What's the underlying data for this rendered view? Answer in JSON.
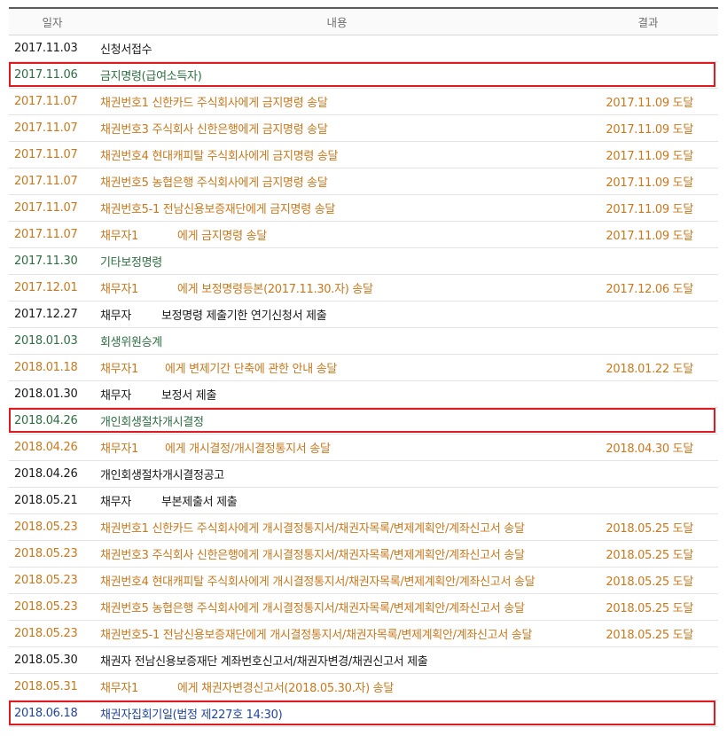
{
  "header": {
    "date": "일자",
    "content": "내용",
    "result": "결과"
  },
  "rows": [
    {
      "date": "2017.11.03",
      "content": "신청서접수",
      "result": "",
      "color": "black"
    },
    {
      "date": "2017.11.06",
      "content": "금지명령(급여소득자)",
      "result": "",
      "color": "green",
      "highlighted": true
    },
    {
      "date": "2017.11.07",
      "content": "채권번호1 신한카드 주식회사에게 금지명령 송달",
      "result": "2017.11.09 도달",
      "color": "orange"
    },
    {
      "date": "2017.11.07",
      "content": "채권번호3 주식회사 신한은행에게 금지명령 송달",
      "result": "2017.11.09 도달",
      "color": "orange"
    },
    {
      "date": "2017.11.07",
      "content": "채권번호4 현대캐피탈 주식회사에게 금지명령 송달",
      "result": "2017.11.09 도달",
      "color": "orange"
    },
    {
      "date": "2017.11.07",
      "content": "채권번호5 농협은행 주식회사에게 금지명령 송달",
      "result": "2017.11.09 도달",
      "color": "orange"
    },
    {
      "date": "2017.11.07",
      "content": "채권번호5-1 전남신용보증재단에게 금지명령 송달",
      "result": "2017.11.09 도달",
      "color": "orange"
    },
    {
      "date": "2017.11.07",
      "content": "채무자1",
      "content2": "에게 금지명령 송달",
      "gap": 44,
      "result": "2017.11.09 도달",
      "color": "orange"
    },
    {
      "date": "2017.11.30",
      "content": "기타보정명령",
      "result": "",
      "color": "green"
    },
    {
      "date": "2017.12.01",
      "content": "채무자1",
      "content2": "에게 보정명령등본(2017.11.30.자) 송달",
      "gap": 44,
      "result": "2017.12.06 도달",
      "color": "orange"
    },
    {
      "date": "2017.12.27",
      "content": "채무자",
      "content2": "보정명령 제출기한 연기신청서 제출",
      "gap": 34,
      "result": "",
      "color": "black"
    },
    {
      "date": "2018.01.03",
      "content": "회생위원승계",
      "result": "",
      "color": "green"
    },
    {
      "date": "2018.01.18",
      "content": "채무자1",
      "content2": "에게 변제기간 단축에 관한 안내 송달",
      "gap": 30,
      "result": "2018.01.22 도달",
      "color": "orange"
    },
    {
      "date": "2018.01.30",
      "content": "채무자",
      "content2": "보정서 제출",
      "gap": 34,
      "result": "",
      "color": "black"
    },
    {
      "date": "2018.04.26",
      "content": "개인회생절차개시결정",
      "result": "",
      "color": "green",
      "highlighted": true
    },
    {
      "date": "2018.04.26",
      "content": "채무자1",
      "content2": "에게 개시결정/개시결정통지서 송달",
      "gap": 30,
      "result": "2018.04.30 도달",
      "color": "orange"
    },
    {
      "date": "2018.04.26",
      "content": "개인회생절차개시결정공고",
      "result": "",
      "color": "black"
    },
    {
      "date": "2018.05.21",
      "content": "채무자",
      "content2": "부본제출서 제출",
      "gap": 34,
      "result": "",
      "color": "black"
    },
    {
      "date": "2018.05.23",
      "content": "채권번호1 신한카드 주식회사에게 개시결정통지서/채권자목록/변제계획안/계좌신고서 송달",
      "result": "2018.05.25 도달",
      "color": "orange"
    },
    {
      "date": "2018.05.23",
      "content": "채권번호3 주식회사 신한은행에게 개시결정통지서/채권자목록/변제계획안/계좌신고서 송달",
      "result": "2018.05.25 도달",
      "color": "orange"
    },
    {
      "date": "2018.05.23",
      "content": "채권번호4 현대캐피탈 주식회사에게 개시결정통지서/채권자목록/변제계획안/계좌신고서 송달",
      "result": "2018.05.25 도달",
      "color": "orange"
    },
    {
      "date": "2018.05.23",
      "content": "채권번호5 농협은행 주식회사에게 개시결정통지서/채권자목록/변제계획안/계좌신고서 송달",
      "result": "2018.05.25 도달",
      "color": "orange"
    },
    {
      "date": "2018.05.23",
      "content": "채권번호5-1 전남신용보증재단에게 개시결정통지서/채권자목록/변제계획안/계좌신고서 송달",
      "result": "2018.05.25 도달",
      "color": "orange"
    },
    {
      "date": "2018.05.30",
      "content": "채권자 전남신용보증재단 계좌번호신고서/채권자변경/채권신고서 제출",
      "result": "",
      "color": "black"
    },
    {
      "date": "2018.05.31",
      "content": "채무자1",
      "content2": "에게 채권자변경신고서(2018.05.30.자) 송달",
      "gap": 44,
      "result": "",
      "color": "orange"
    },
    {
      "date": "2018.06.18",
      "content": "채권자집회기일(법정 제227호 14:30)",
      "result": "",
      "color": "blue",
      "highlighted": true
    }
  ],
  "colors": {
    "black": "#1a1a1a",
    "orange": "#c8781e",
    "green": "#2f6e43",
    "blue": "#23449b",
    "highlight": "#e11a22"
  }
}
